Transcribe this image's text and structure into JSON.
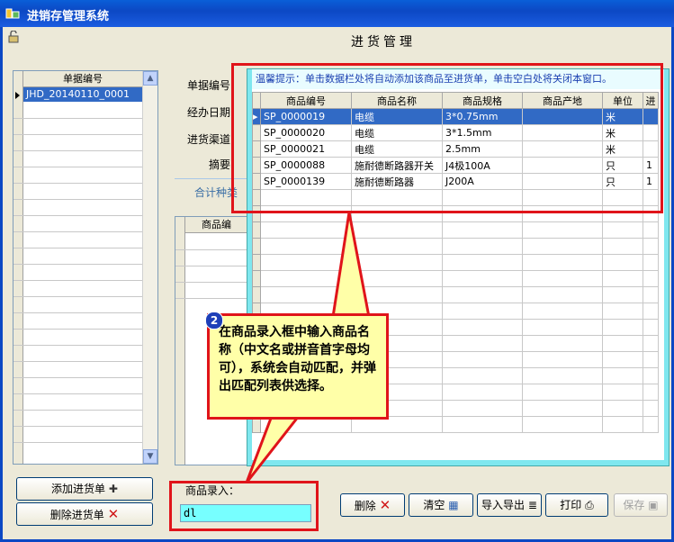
{
  "window": {
    "title": "进销存管理系统"
  },
  "page_title": "进货管理",
  "doc_list": {
    "header": "单据编号",
    "rows": [
      "JHD_20140110_0001"
    ]
  },
  "form": {
    "doc_no_label": "单据编号：",
    "date_label": "经办日期：",
    "channel_label": "进货渠道：",
    "summary_label": "摘要：",
    "total_label": "合计种类"
  },
  "product_grid": {
    "header": "商品编"
  },
  "popup": {
    "hint": "温馨提示：单击数据栏处将自动添加该商品至进货单，单击空白处将关闭本窗口。",
    "columns": [
      "商品编号",
      "商品名称",
      "商品规格",
      "商品产地",
      "单位",
      "进"
    ],
    "rows": [
      [
        "SP_0000019",
        "电缆",
        "3*0.75mm",
        "",
        "米",
        ""
      ],
      [
        "SP_0000020",
        "电缆",
        "3*1.5mm",
        "",
        "米",
        ""
      ],
      [
        "SP_0000021",
        "电缆",
        "2.5mm",
        "",
        "米",
        ""
      ],
      [
        "SP_0000088",
        "施耐德断路器开关",
        "J4极100A",
        "",
        "只",
        "1"
      ],
      [
        "SP_0000139",
        "施耐德断路器",
        "J200A",
        "",
        "只",
        "1"
      ]
    ]
  },
  "callout": {
    "step": "2",
    "text": "在商品录入框中输入商品名称（中文名或拼音首字母均可），系统会自动匹配，并弹出匹配列表供选择。"
  },
  "entry": {
    "label": "商品录入：",
    "value": "dl"
  },
  "buttons": {
    "add_doc": "添加进货单",
    "delete_doc": "删除进货单",
    "delete": "删除",
    "clear": "清空",
    "import_export": "导入导出",
    "print": "打印",
    "save": "保存"
  },
  "colors": {
    "highlight": "#e0141a",
    "selection": "#316ac5",
    "popup_border": "#7fe7ef",
    "callout_bg": "#ffffa8"
  }
}
